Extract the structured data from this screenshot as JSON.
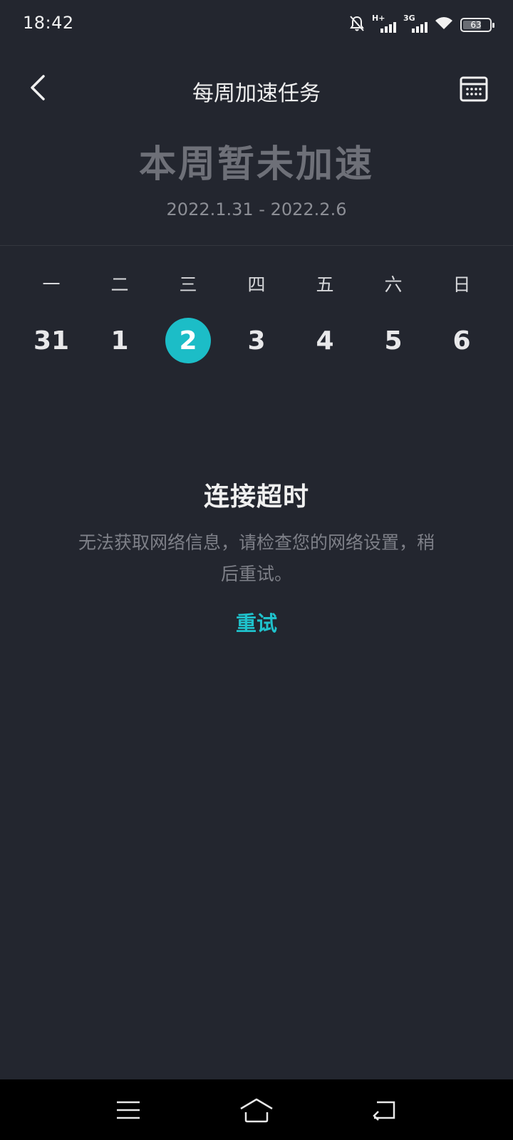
{
  "status_bar": {
    "time": "18:42",
    "network1": "H+",
    "network2": "3G",
    "battery_level": "63",
    "icons": [
      "bell-off-icon",
      "signal-icon",
      "signal-icon",
      "wifi-icon",
      "battery-icon"
    ]
  },
  "header": {
    "title": "每周加速任务",
    "back_icon": "back-chevron-icon",
    "calendar_icon": "calendar-icon"
  },
  "week": {
    "status": "本周暂未加速",
    "range": "2022.1.31 - 2022.2.6",
    "weekdays": [
      "一",
      "二",
      "三",
      "四",
      "五",
      "六",
      "日"
    ],
    "dates": [
      "31",
      "1",
      "2",
      "3",
      "4",
      "5",
      "6"
    ],
    "selected_date": "2"
  },
  "error": {
    "title": "连接超时",
    "message": "无法获取网络信息，请检查您的网络设置，稍后重试。",
    "retry_label": "重试"
  },
  "nav_bar": {
    "icons": [
      "menu-icon",
      "home-icon",
      "back-icon"
    ]
  },
  "colors": {
    "background": "#23262f",
    "accent": "#1cbdc7",
    "muted_text": "#6e7078"
  }
}
